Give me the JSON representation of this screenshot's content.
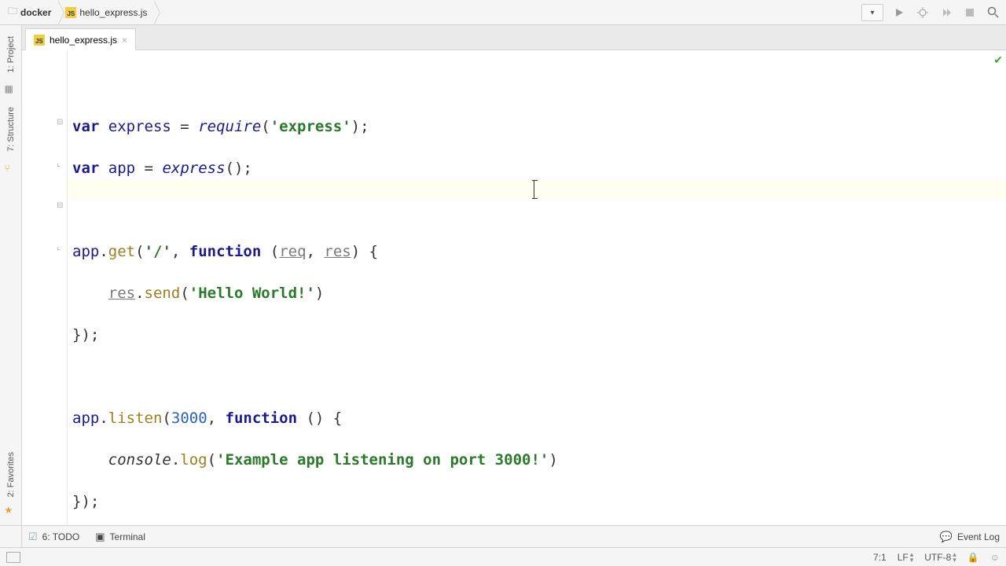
{
  "breadcrumb": {
    "project": "docker",
    "file": "hello_express.js"
  },
  "tab": {
    "filename": "hello_express.js"
  },
  "sidebar": {
    "project": "1: Project",
    "structure": "7: Structure",
    "favorites": "2: Favorites"
  },
  "code": {
    "l1": {
      "var": "var",
      "ident": "express",
      "eq": " = ",
      "require": "require",
      "p1": "(",
      "str": "'express'",
      "p2": ");"
    },
    "l2": {
      "var": "var",
      "ident": "app",
      "eq": " = ",
      "express": "express",
      "p": "();"
    },
    "l4": {
      "app": "app",
      "dot": ".",
      "get": "get",
      "p1": "(",
      "str": "'/'",
      "c": ", ",
      "func": "function",
      "p2": " (",
      "req": "req",
      "c2": ", ",
      "res": "res",
      "p3": ") {"
    },
    "l5": {
      "indent": "    ",
      "res": "res",
      "dot": ".",
      "send": "send",
      "p1": "(",
      "str": "'Hello World!'",
      "p2": ")"
    },
    "l6": {
      "close": "});"
    },
    "l8": {
      "app": "app",
      "dot": ".",
      "listen": "listen",
      "p1": "(",
      "num": "3000",
      "c": ", ",
      "func": "function",
      "p2": " () {"
    },
    "l9": {
      "indent": "    ",
      "console": "console",
      "dot": ".",
      "log": "log",
      "p1": "(",
      "str": "'Example app listening on port 3000!'",
      "p2": ")"
    },
    "l10": {
      "close": "});"
    }
  },
  "bottom": {
    "todo": "6: TODO",
    "terminal": "Terminal",
    "eventlog": "Event Log"
  },
  "status": {
    "pos": "7:1",
    "lf": "LF",
    "enc": "UTF-8"
  }
}
